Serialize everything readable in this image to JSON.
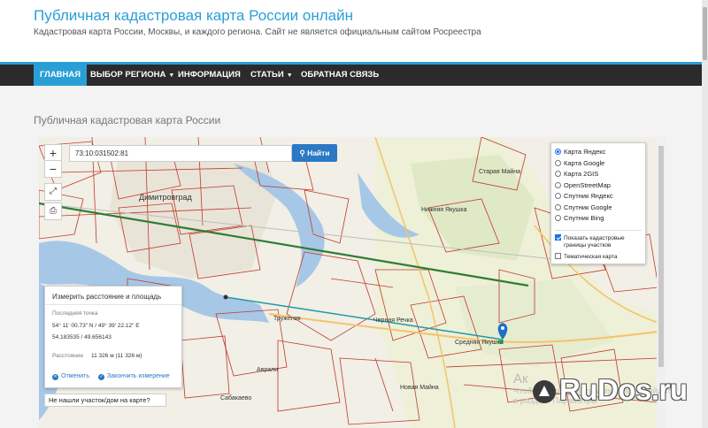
{
  "site": {
    "title": "Публичная кадастровая карта России онлайн",
    "description": "Кадастровая карта России, Москвы, и каждого региона. Сайт не является официальным сайтом Росреестра",
    "accent_color": "#2a9fd6",
    "nav_bg_color": "#2b2b2b"
  },
  "nav": {
    "items": [
      {
        "label": "ГЛАВНАЯ"
      },
      {
        "label": "ВЫБОР РЕГИОНА"
      },
      {
        "label": "ИНФОРМАЦИЯ"
      },
      {
        "label": "СТАТЬИ"
      },
      {
        "label": "ОБРАТНАЯ СВЯЗЬ"
      }
    ]
  },
  "page": {
    "heading": "Публичная кадастровая карта России"
  },
  "map": {
    "zoom_in": "+",
    "zoom_out": "−",
    "fullscreen_icon": "fullscreen-icon",
    "print_icon": "print-icon",
    "search": {
      "value": "73:10:031502:81",
      "button_label": "Найти",
      "button_icon": "search-icon"
    },
    "layers": {
      "options": [
        {
          "label": "Карта Яндекс",
          "selected": true
        },
        {
          "label": "Карта Google",
          "selected": false
        },
        {
          "label": "Карта 2GIS",
          "selected": false
        },
        {
          "label": "OpenStreetMap",
          "selected": false
        },
        {
          "label": "Спутник Яндекс",
          "selected": false
        },
        {
          "label": "Спутник Google",
          "selected": false
        },
        {
          "label": "Спутник Bing",
          "selected": false
        }
      ],
      "show_borders_label_1": "Показать кадастровые",
      "show_borders_label_2": "границы участков",
      "show_borders_checked": true,
      "thematic_label": "Тематическая карта",
      "thematic_checked": false
    },
    "measure": {
      "title": "Измерить расстояние и площадь",
      "last_point_label": "Последняя точка",
      "coords_dms": "54° 11' 00.73\" N / 49° 39' 22.12\" E",
      "coords_dec": "54.183535 / 49.656143",
      "distance_label": "Расстояние",
      "distance_value": "11 326 м (11 326 м)",
      "cancel_label": "Отменить",
      "finish_label": "Закончить измерение"
    },
    "not_found": "Не нашли участок/дом на карте?",
    "places": {
      "city": "Димитровград",
      "p1": "Старая Майна",
      "p2": "Нижняя Якушка",
      "p3": "Труженик",
      "p4": "Черная Речка",
      "p5": "Средняя Якушка",
      "p6": "Аврали",
      "p7": "Новая Майна",
      "p8": "Сабакаево"
    }
  },
  "overlay": {
    "activate_title": "Ак",
    "activate_text": "Чтобы активировать Windows, перейдите в раздел \"Параметры\".",
    "watermark": "RuDos.ru"
  }
}
